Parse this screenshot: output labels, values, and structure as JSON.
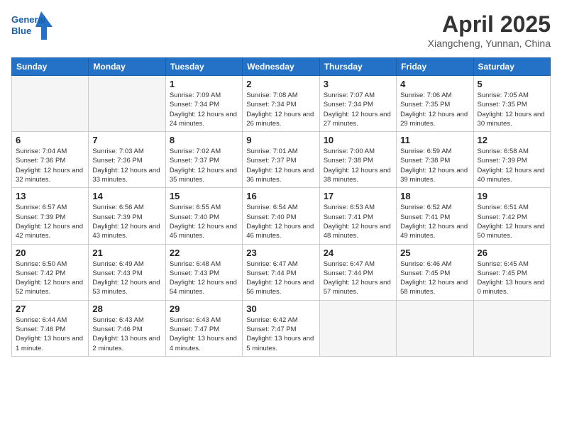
{
  "header": {
    "logo_text_general": "General",
    "logo_text_blue": "Blue",
    "month_title": "April 2025",
    "location": "Xiangcheng, Yunnan, China"
  },
  "days_of_week": [
    "Sunday",
    "Monday",
    "Tuesday",
    "Wednesday",
    "Thursday",
    "Friday",
    "Saturday"
  ],
  "weeks": [
    [
      {
        "num": "",
        "info": ""
      },
      {
        "num": "",
        "info": ""
      },
      {
        "num": "1",
        "info": "Sunrise: 7:09 AM\nSunset: 7:34 PM\nDaylight: 12 hours and 24 minutes."
      },
      {
        "num": "2",
        "info": "Sunrise: 7:08 AM\nSunset: 7:34 PM\nDaylight: 12 hours and 26 minutes."
      },
      {
        "num": "3",
        "info": "Sunrise: 7:07 AM\nSunset: 7:34 PM\nDaylight: 12 hours and 27 minutes."
      },
      {
        "num": "4",
        "info": "Sunrise: 7:06 AM\nSunset: 7:35 PM\nDaylight: 12 hours and 29 minutes."
      },
      {
        "num": "5",
        "info": "Sunrise: 7:05 AM\nSunset: 7:35 PM\nDaylight: 12 hours and 30 minutes."
      }
    ],
    [
      {
        "num": "6",
        "info": "Sunrise: 7:04 AM\nSunset: 7:36 PM\nDaylight: 12 hours and 32 minutes."
      },
      {
        "num": "7",
        "info": "Sunrise: 7:03 AM\nSunset: 7:36 PM\nDaylight: 12 hours and 33 minutes."
      },
      {
        "num": "8",
        "info": "Sunrise: 7:02 AM\nSunset: 7:37 PM\nDaylight: 12 hours and 35 minutes."
      },
      {
        "num": "9",
        "info": "Sunrise: 7:01 AM\nSunset: 7:37 PM\nDaylight: 12 hours and 36 minutes."
      },
      {
        "num": "10",
        "info": "Sunrise: 7:00 AM\nSunset: 7:38 PM\nDaylight: 12 hours and 38 minutes."
      },
      {
        "num": "11",
        "info": "Sunrise: 6:59 AM\nSunset: 7:38 PM\nDaylight: 12 hours and 39 minutes."
      },
      {
        "num": "12",
        "info": "Sunrise: 6:58 AM\nSunset: 7:39 PM\nDaylight: 12 hours and 40 minutes."
      }
    ],
    [
      {
        "num": "13",
        "info": "Sunrise: 6:57 AM\nSunset: 7:39 PM\nDaylight: 12 hours and 42 minutes."
      },
      {
        "num": "14",
        "info": "Sunrise: 6:56 AM\nSunset: 7:39 PM\nDaylight: 12 hours and 43 minutes."
      },
      {
        "num": "15",
        "info": "Sunrise: 6:55 AM\nSunset: 7:40 PM\nDaylight: 12 hours and 45 minutes."
      },
      {
        "num": "16",
        "info": "Sunrise: 6:54 AM\nSunset: 7:40 PM\nDaylight: 12 hours and 46 minutes."
      },
      {
        "num": "17",
        "info": "Sunrise: 6:53 AM\nSunset: 7:41 PM\nDaylight: 12 hours and 48 minutes."
      },
      {
        "num": "18",
        "info": "Sunrise: 6:52 AM\nSunset: 7:41 PM\nDaylight: 12 hours and 49 minutes."
      },
      {
        "num": "19",
        "info": "Sunrise: 6:51 AM\nSunset: 7:42 PM\nDaylight: 12 hours and 50 minutes."
      }
    ],
    [
      {
        "num": "20",
        "info": "Sunrise: 6:50 AM\nSunset: 7:42 PM\nDaylight: 12 hours and 52 minutes."
      },
      {
        "num": "21",
        "info": "Sunrise: 6:49 AM\nSunset: 7:43 PM\nDaylight: 12 hours and 53 minutes."
      },
      {
        "num": "22",
        "info": "Sunrise: 6:48 AM\nSunset: 7:43 PM\nDaylight: 12 hours and 54 minutes."
      },
      {
        "num": "23",
        "info": "Sunrise: 6:47 AM\nSunset: 7:44 PM\nDaylight: 12 hours and 56 minutes."
      },
      {
        "num": "24",
        "info": "Sunrise: 6:47 AM\nSunset: 7:44 PM\nDaylight: 12 hours and 57 minutes."
      },
      {
        "num": "25",
        "info": "Sunrise: 6:46 AM\nSunset: 7:45 PM\nDaylight: 12 hours and 58 minutes."
      },
      {
        "num": "26",
        "info": "Sunrise: 6:45 AM\nSunset: 7:45 PM\nDaylight: 13 hours and 0 minutes."
      }
    ],
    [
      {
        "num": "27",
        "info": "Sunrise: 6:44 AM\nSunset: 7:46 PM\nDaylight: 13 hours and 1 minute."
      },
      {
        "num": "28",
        "info": "Sunrise: 6:43 AM\nSunset: 7:46 PM\nDaylight: 13 hours and 2 minutes."
      },
      {
        "num": "29",
        "info": "Sunrise: 6:43 AM\nSunset: 7:47 PM\nDaylight: 13 hours and 4 minutes."
      },
      {
        "num": "30",
        "info": "Sunrise: 6:42 AM\nSunset: 7:47 PM\nDaylight: 13 hours and 5 minutes."
      },
      {
        "num": "",
        "info": ""
      },
      {
        "num": "",
        "info": ""
      },
      {
        "num": "",
        "info": ""
      }
    ]
  ]
}
